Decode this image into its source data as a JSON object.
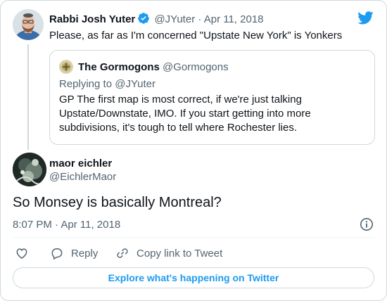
{
  "parent_tweet": {
    "author_name": "Rabbi Josh Yuter",
    "handle": "@JYuter",
    "separator": "·",
    "date": "Apr 11, 2018",
    "text": "Please, as far as I'm concerned \"Upstate New York\" is Yonkers"
  },
  "quoted_tweet": {
    "author_name": "The Gormogons",
    "handle": "@Gormogons",
    "replying_to": "Replying to @JYuter",
    "text_lines": [
      "GP The first map is most correct, if we're just talking",
      "Upstate/Downstate, IMO. If you start getting into more",
      "subdivisions, it's tough to tell where Rochester lies."
    ]
  },
  "main_tweet": {
    "author_name": "maor eichler",
    "handle": "@EichlerMaor",
    "text": "So Monsey is basically Montreal?",
    "time": "8:07 PM",
    "separator": "·",
    "date": "Apr 11, 2018"
  },
  "actions": {
    "reply_label": "Reply",
    "copy_link_label": "Copy link to Tweet"
  },
  "explore_button": {
    "label": "Explore what's happening on Twitter"
  },
  "colors": {
    "accent": "#1d9bf0",
    "text_primary": "#0f1419",
    "text_secondary": "#536471",
    "border": "#cfd9de"
  },
  "icons": {
    "brand": "twitter-bird-icon",
    "verified": "verified-badge-icon",
    "info": "info-icon",
    "like": "heart-icon",
    "reply": "speech-bubble-icon",
    "copy_link": "link-icon"
  }
}
